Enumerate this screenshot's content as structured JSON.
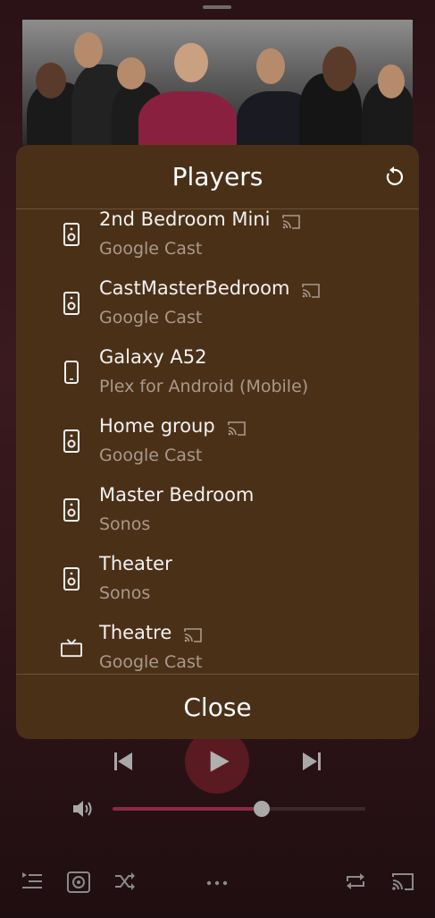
{
  "dialog": {
    "title": "Players",
    "close_label": "Close",
    "players": [
      {
        "name": "2nd Bedroom Mini",
        "type": "Google Cast",
        "device": "speaker",
        "cast": true
      },
      {
        "name": "CastMasterBedroom",
        "type": "Google Cast",
        "device": "speaker",
        "cast": true
      },
      {
        "name": "Galaxy A52",
        "type": "Plex for Android (Mobile)",
        "device": "phone",
        "cast": false
      },
      {
        "name": "Home group",
        "type": "Google Cast",
        "device": "speaker",
        "cast": true
      },
      {
        "name": "Master Bedroom",
        "type": "Sonos",
        "device": "speaker",
        "cast": false
      },
      {
        "name": "Theater",
        "type": "Sonos",
        "device": "speaker",
        "cast": false
      },
      {
        "name": "Theatre",
        "type": "Google Cast",
        "device": "tv",
        "cast": true
      }
    ]
  },
  "player": {
    "volume": 0.59
  },
  "colors": {
    "dialog_bg": "#4b3018",
    "accent": "#8a2a46",
    "text_primary": "#f2f2f2",
    "text_secondary": "#a89a8c"
  },
  "icons": {
    "refresh": "refresh-icon",
    "speaker": "speaker-icon",
    "phone": "phone-icon",
    "tv": "tv-icon",
    "cast": "cast-icon"
  }
}
